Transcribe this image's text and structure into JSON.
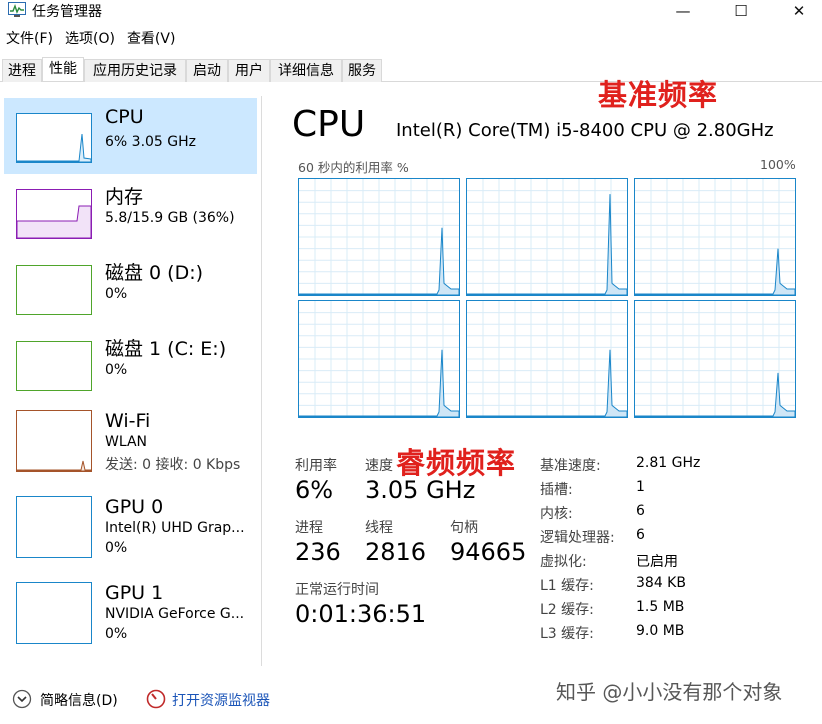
{
  "window": {
    "title": "任务管理器",
    "minimize_glyph": "—",
    "maximize_glyph": "☐",
    "close_glyph": "✕"
  },
  "menu": [
    "文件(F)",
    "选项(O)",
    "查看(V)"
  ],
  "tabs": [
    "进程",
    "性能",
    "应用历史记录",
    "启动",
    "用户",
    "详细信息",
    "服务"
  ],
  "active_tab": "性能",
  "sidebar": [
    {
      "name": "CPU",
      "line1": "6% 3.05 GHz",
      "line2": "",
      "color": "#1a86c9",
      "selected": true
    },
    {
      "name": "内存",
      "line1": "5.8/15.9 GB (36%)",
      "line2": "",
      "color": "#8b1db3"
    },
    {
      "name": "磁盘 0 (D:)",
      "line1": "0%",
      "line2": "",
      "color": "#4fa52b"
    },
    {
      "name": "磁盘 1 (C: E:)",
      "line1": "0%",
      "line2": "",
      "color": "#4fa52b"
    },
    {
      "name": "Wi-Fi",
      "line1": "WLAN",
      "line2": "发送: 0 接收: 0 Kbps",
      "color": "#a5542a"
    },
    {
      "name": "GPU 0",
      "line1": "Intel(R) UHD Grap...",
      "line2": "0%",
      "color": "#1a86c9"
    },
    {
      "name": "GPU 1",
      "line1": "NVIDIA GeForce G...",
      "line2": "0%",
      "color": "#1a86c9"
    }
  ],
  "main": {
    "title": "CPU",
    "model": "Intel(R) Core(TM) i5-8400 CPU @ 2.80GHz",
    "graph_label": "60 秒内的利用率 %",
    "graph_max": "100%",
    "core_spikes": [
      0.58,
      0.87,
      0.4,
      0.58,
      0.58,
      0.38
    ]
  },
  "stats": {
    "utilization_label": "利用率",
    "utilization": "6%",
    "speed_label": "速度",
    "speed": "3.05 GHz",
    "processes_label": "进程",
    "processes": "236",
    "threads_label": "线程",
    "threads": "2816",
    "handles_label": "句柄",
    "handles": "94665",
    "uptime_label": "正常运行时间",
    "uptime": "0:01:36:51"
  },
  "info": [
    {
      "label": "基准速度:",
      "value": "2.81 GHz"
    },
    {
      "label": "插槽:",
      "value": "1"
    },
    {
      "label": "内核:",
      "value": "6"
    },
    {
      "label": "逻辑处理器:",
      "value": "6"
    },
    {
      "label": "虚拟化:",
      "value": "已启用"
    },
    {
      "label": "L1 缓存:",
      "value": "384 KB"
    },
    {
      "label": "L2 缓存:",
      "value": "1.5 MB"
    },
    {
      "label": "L3 缓存:",
      "value": "9.0 MB"
    }
  ],
  "annotations": {
    "base_freq": "基准频率",
    "turbo_freq": "睿频频率"
  },
  "footer": {
    "summary": "简略信息(D)",
    "resource_monitor": "打开资源监视器"
  },
  "watermark": "知乎 @小小没有那个对象",
  "colors": {
    "accent": "#1a86c9",
    "selected_bg": "#cce8ff",
    "annotation": "#e0211d"
  }
}
